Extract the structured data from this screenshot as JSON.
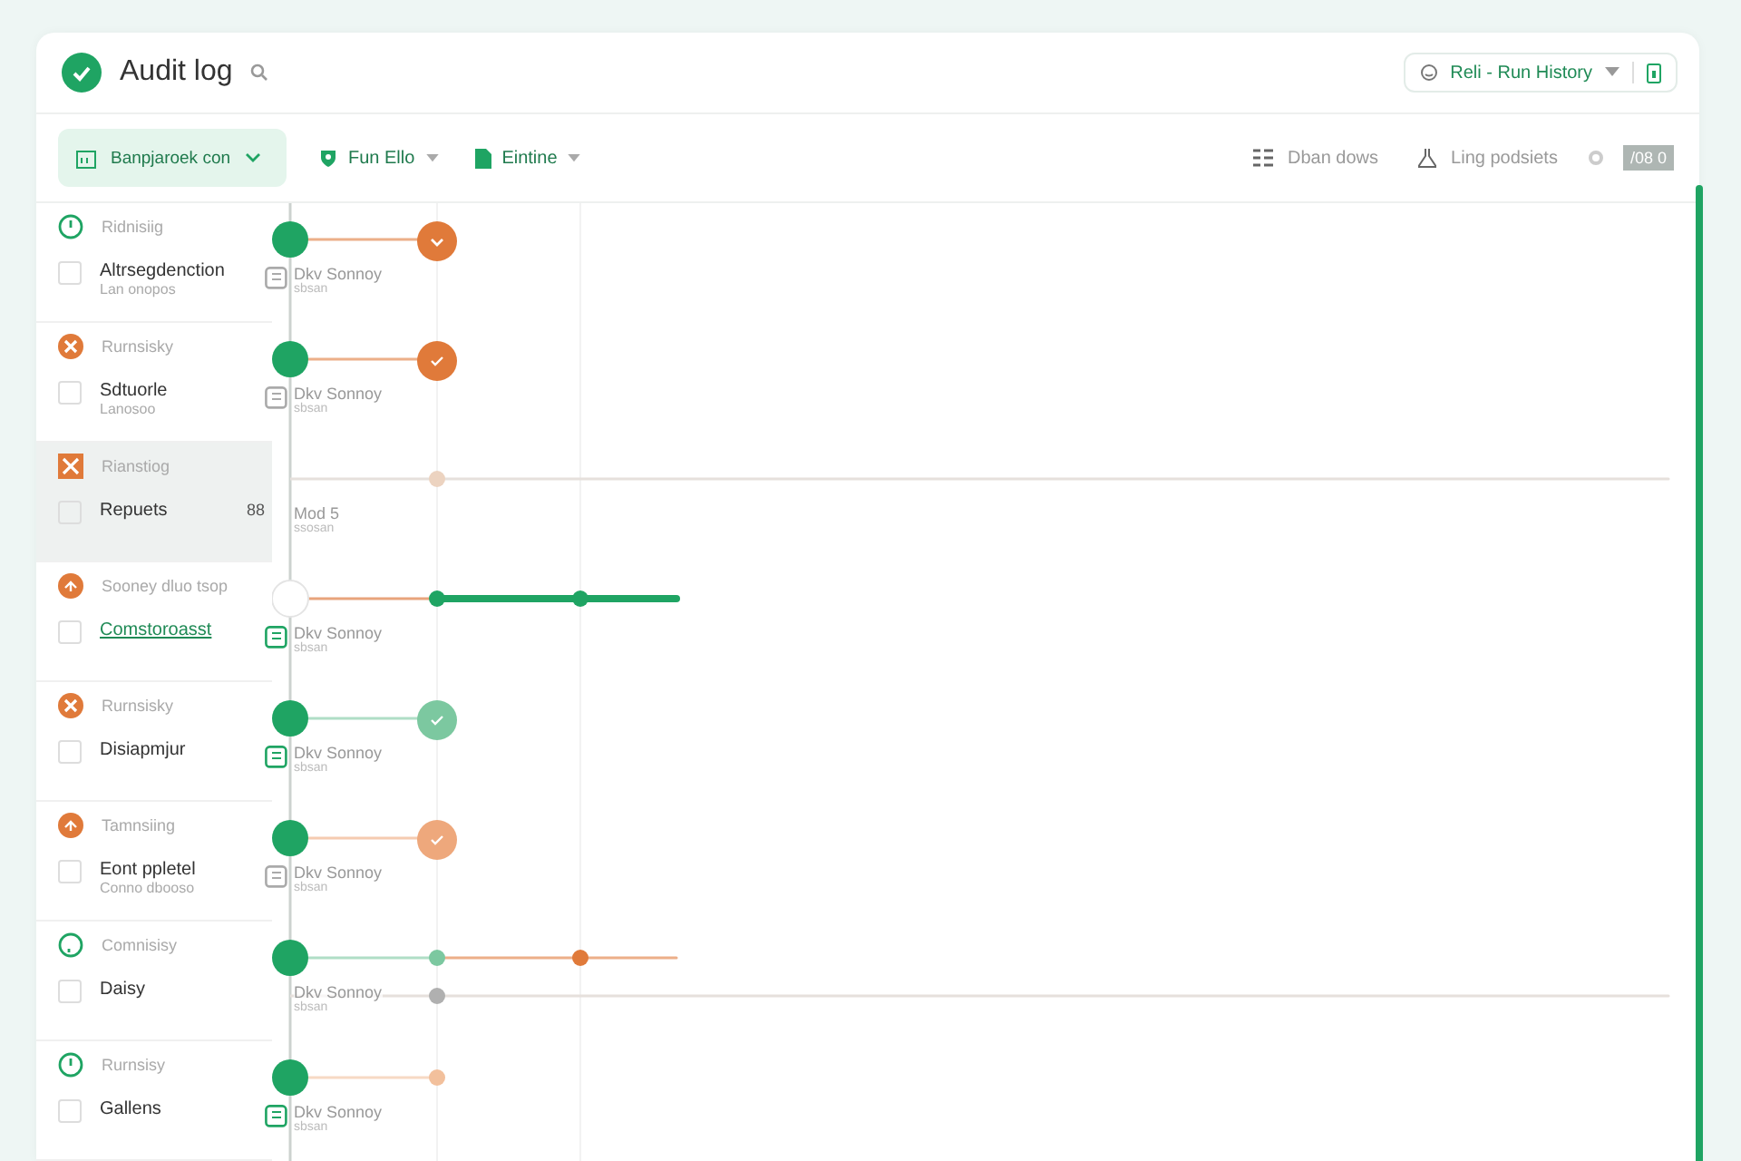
{
  "header": {
    "title": "Audit log",
    "history": "Reli - Run History"
  },
  "toolbar": {
    "sidebar_button": "Banpjaroek con",
    "filters": [
      "Fun Ello",
      "Eintine"
    ],
    "actions": [
      "Dban dows",
      "Ling podsiets"
    ],
    "badge": "/08 0"
  },
  "rows": [
    {
      "status": {
        "kind": "clock",
        "color": "#1fa463",
        "text": "Ridnisiig"
      },
      "name": "Altrsegdenction",
      "sub": "Lan onopos",
      "checked": false,
      "link": false,
      "highlighted": false,
      "event_icon_active": false,
      "event": "Dkv Sonnoy",
      "event_sub": "sbsan",
      "track": {
        "kind": "node",
        "stops": [
          {
            "kind": "badge-chevron",
            "color": "#e07a3a"
          }
        ]
      }
    },
    {
      "status": {
        "kind": "cross",
        "color": "#e07a3a",
        "text": "Rurnsisky"
      },
      "name": "Sdtuorle",
      "sub": "Lanosoo",
      "checked": false,
      "link": false,
      "highlighted": false,
      "event_icon_active": false,
      "event": "Dkv Sonnoy",
      "event_sub": "sbsan",
      "track": {
        "kind": "node",
        "stops": [
          {
            "kind": "badge-check",
            "color": "#e07a3a"
          }
        ]
      }
    },
    {
      "status": {
        "kind": "square",
        "color": "#e07a3a",
        "text": "Rianstiog"
      },
      "name": "Repuets",
      "count": "88",
      "checked": false,
      "link": false,
      "highlighted": true,
      "event": "Mod 5",
      "event_sub": "ssosan",
      "track": {
        "kind": "line",
        "stops": [
          {
            "kind": "dot",
            "color": "#ecd3c0"
          }
        ]
      }
    },
    {
      "status": {
        "kind": "burst",
        "color": "#e07a3a",
        "text": "Sooney dluo tsop"
      },
      "name": "Comstoroasst",
      "checked": false,
      "link": true,
      "highlighted": false,
      "event_icon_active": true,
      "event": "Dkv Sonnoy",
      "event_sub": "sbsan",
      "track": {
        "kind": "open",
        "stops": [
          {
            "kind": "dot",
            "color": "#1fa463"
          },
          {
            "kind": "dot",
            "color": "#1fa463"
          }
        ]
      }
    },
    {
      "status": {
        "kind": "cross",
        "color": "#e07a3a",
        "text": "Rurnsisky"
      },
      "name": "Disiapmjur",
      "checked": false,
      "link": false,
      "highlighted": false,
      "event_icon_active": true,
      "event": "Dkv Sonnoy",
      "event_sub": "sbsan",
      "track": {
        "kind": "node",
        "stops": [
          {
            "kind": "badge-check",
            "color": "#7cc8a0"
          }
        ]
      }
    },
    {
      "status": {
        "kind": "burst",
        "color": "#e07a3a",
        "text": "Tamnsiing"
      },
      "name": "Eont ppletel",
      "sub": "Conno dbooso",
      "checked": false,
      "link": false,
      "highlighted": false,
      "event_icon_active": false,
      "event": "Dkv Sonnoy",
      "event_sub": "sbsan",
      "track": {
        "kind": "node",
        "stops": [
          {
            "kind": "badge-check",
            "color": "#eea87c"
          }
        ]
      }
    },
    {
      "status": {
        "kind": "ring",
        "color": "#1fa463",
        "text": "Comnisisy"
      },
      "name": "Daisy",
      "checked": false,
      "link": false,
      "highlighted": false,
      "event": "Dkv Sonnoy",
      "event_sub": "sbsan",
      "track": {
        "kind": "node",
        "stops": [
          {
            "kind": "dot",
            "color": "#7cc8a0"
          },
          {
            "kind": "dot",
            "color": "#e07a3a"
          }
        ]
      },
      "subtrack": {
        "kind": "line",
        "stops": [
          {
            "kind": "dot",
            "color": "#b0b0b0"
          }
        ]
      }
    },
    {
      "status": {
        "kind": "clock",
        "color": "#1fa463",
        "text": "Rurnsisy"
      },
      "name": "Gallens",
      "checked": false,
      "link": false,
      "highlighted": false,
      "event_icon_active": true,
      "event": "Dkv Sonnoy",
      "event_sub": "sbsan",
      "track": {
        "kind": "node",
        "stops": [
          {
            "kind": "dot",
            "color": "#f2c09c"
          }
        ]
      }
    }
  ]
}
